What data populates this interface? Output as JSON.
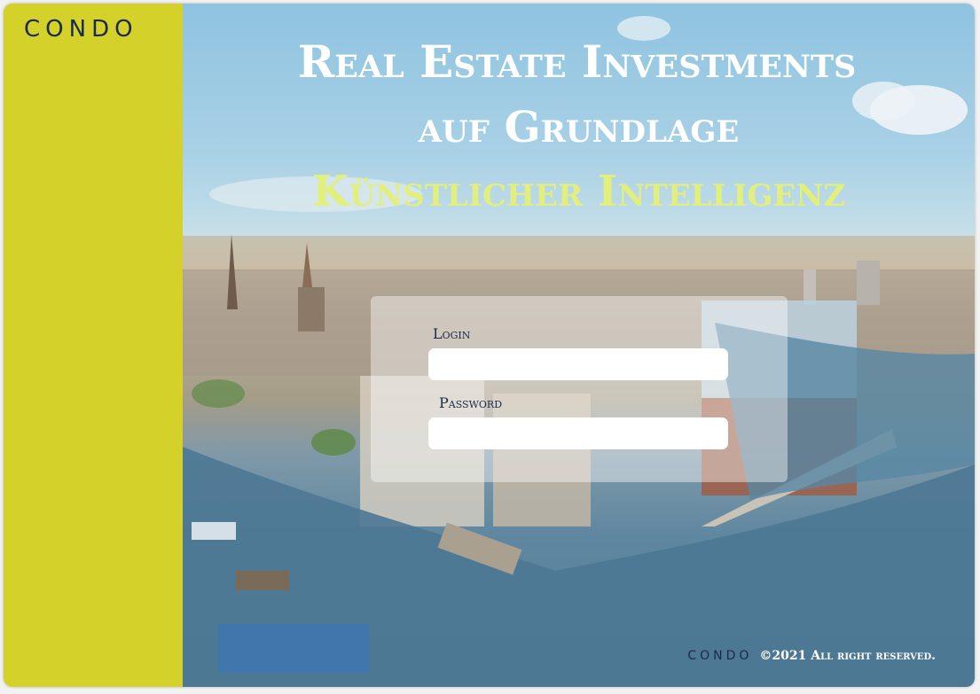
{
  "brand": {
    "name": "CONDO"
  },
  "hero": {
    "line1": "Real Estate Investments",
    "line2": "auf Grundlage",
    "line3": "Künstlicher Intelligenz"
  },
  "login_form": {
    "login_label": "Login",
    "login_value": "",
    "password_label": "Password",
    "password_value": ""
  },
  "footer": {
    "brand": "CONDO",
    "copyright": "©2021 All right reserved."
  },
  "colors": {
    "sidebar": "#d4d12a",
    "navy": "#1b2a4a",
    "accent_text": "#e2ef7c"
  }
}
